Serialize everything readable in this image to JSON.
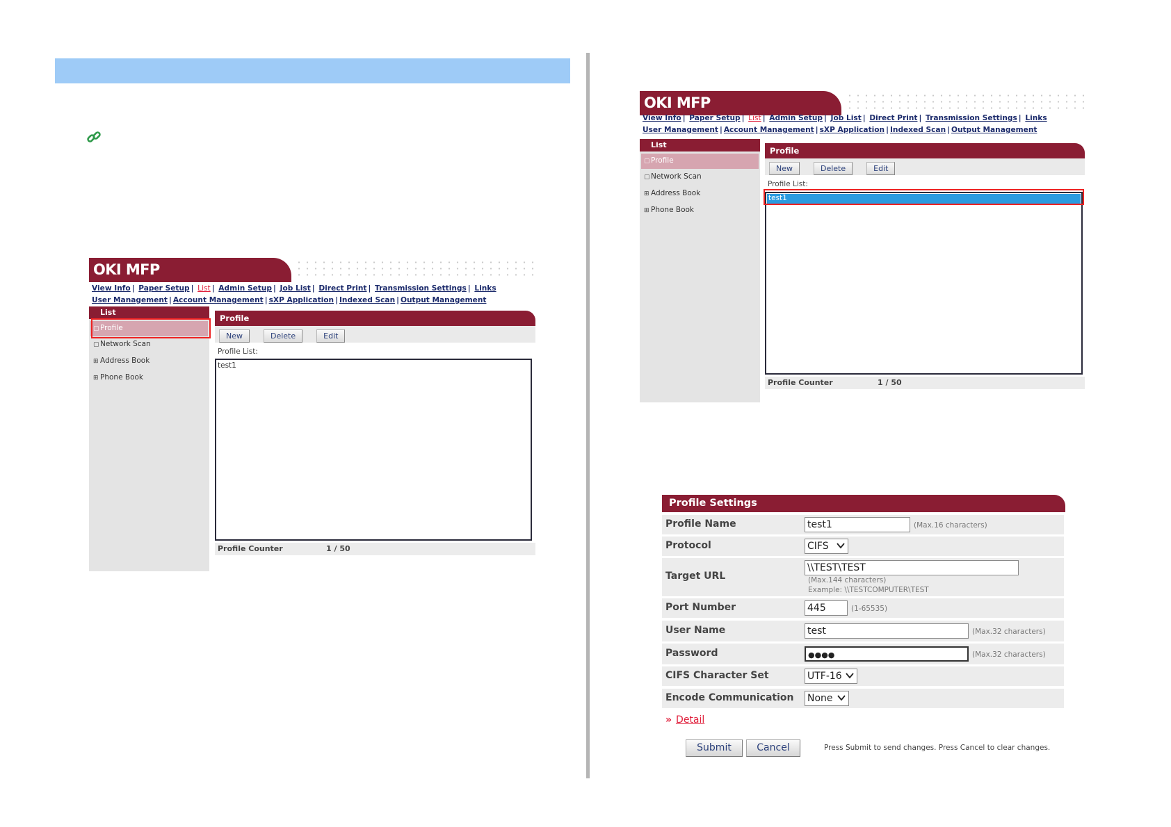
{
  "mfp": {
    "brand": "OKI MFP",
    "nav_row1": [
      "View Info",
      "Paper Setup",
      "List",
      "Admin Setup",
      "Job List",
      "Direct Print",
      "Transmission Settings",
      "Links"
    ],
    "nav_row2": [
      "User Management",
      "Account Management",
      "sXP Application",
      "Indexed Scan",
      "Output Management"
    ],
    "active_nav": "List",
    "sidebar": {
      "title": "List",
      "items": [
        {
          "bullet": "▢",
          "label": "Profile"
        },
        {
          "bullet": "▢",
          "label": "Network Scan"
        },
        {
          "bullet": "⊞",
          "label": "Address Book"
        },
        {
          "bullet": "⊞",
          "label": "Phone Book"
        }
      ],
      "selected": "Profile"
    },
    "profile": {
      "title": "Profile",
      "buttons": {
        "new": "New",
        "delete": "Delete",
        "edit": "Edit"
      },
      "list_label": "Profile List:",
      "entries": [
        "test1"
      ],
      "counter_label": "Profile Counter",
      "counter_value": "1 / 50"
    }
  },
  "settings": {
    "title": "Profile Settings",
    "profile_name": {
      "label": "Profile Name",
      "value": "test1",
      "hint": "(Max.16 characters)"
    },
    "protocol": {
      "label": "Protocol",
      "value": "CIFS"
    },
    "target_url": {
      "label": "Target URL",
      "value": "\\\\TEST\\TEST",
      "hint1": "(Max.144 characters)",
      "hint2": "Example: \\\\TESTCOMPUTER\\TEST"
    },
    "port_number": {
      "label": "Port Number",
      "value": "445",
      "hint": "(1-65535)"
    },
    "user_name": {
      "label": "User Name",
      "value": "test",
      "hint": "(Max.32 characters)"
    },
    "password": {
      "label": "Password",
      "value": "●●●●",
      "hint": "(Max.32 characters)"
    },
    "cifs_charset": {
      "label": "CIFS Character Set",
      "value": "UTF-16"
    },
    "encode_comm": {
      "label": "Encode Communication",
      "value": "None"
    },
    "detail_link": "Detail",
    "submit": "Submit",
    "cancel": "Cancel",
    "note": "Press Submit to send changes. Press Cancel to clear changes."
  },
  "colors": {
    "brand": "#8a1d33",
    "banner": "#9ecbf7",
    "highlight": "#e22222",
    "selected_row": "#2a9be0"
  }
}
